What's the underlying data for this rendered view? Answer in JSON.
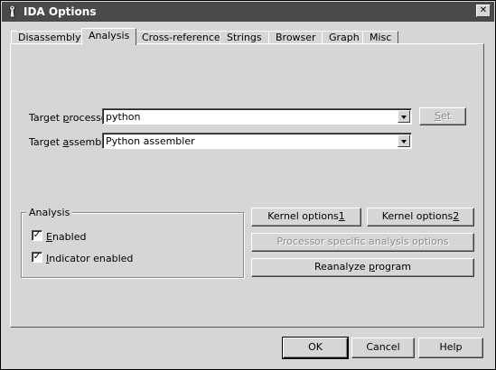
{
  "window": {
    "title": "IDA Options",
    "close_glyph": "✕"
  },
  "tabs": [
    {
      "label": "Disassembly",
      "active": false
    },
    {
      "label": "Analysis",
      "active": true
    },
    {
      "label": "Cross-references",
      "active": false
    },
    {
      "label": "Strings",
      "active": false
    },
    {
      "label": "Browser",
      "active": false
    },
    {
      "label": "Graph",
      "active": false
    },
    {
      "label": "Misc",
      "active": false
    }
  ],
  "target_processor": {
    "label_pre": "Target ",
    "label_accel": "p",
    "label_post": "rocessor",
    "value": "python",
    "set_button": {
      "label_pre": "",
      "label_accel": "S",
      "label_post": "et",
      "enabled": false
    }
  },
  "target_assembler": {
    "label_pre": "Target ",
    "label_accel": "a",
    "label_post": "ssembler",
    "value": "Python assembler"
  },
  "analysis_group": {
    "title": "Analysis",
    "enabled": {
      "label_pre": "",
      "label_accel": "E",
      "label_post": "nabled",
      "checked": true,
      "check_glyph": "✓"
    },
    "indicator": {
      "label_pre": "",
      "label_accel": "I",
      "label_post": "ndicator enabled",
      "checked": true,
      "check_glyph": "✓"
    }
  },
  "kernel_options_1": {
    "label_pre": "Kernel options",
    "label_accel": "1",
    "label_post": ""
  },
  "kernel_options_2": {
    "label_pre": "Kernel options",
    "label_accel": "2",
    "label_post": ""
  },
  "processor_options": {
    "label": "Processor specific analysis options",
    "enabled": false
  },
  "reanalyze": {
    "label_pre": "Reanalyze ",
    "label_accel": "p",
    "label_post": "rogram"
  },
  "footer": {
    "ok": "OK",
    "cancel": "Cancel",
    "help": "Help"
  },
  "icons": {
    "app": "ida-app-icon",
    "close": "close-icon",
    "dropdown": "chevron-down-icon",
    "check": "checkmark-icon"
  }
}
